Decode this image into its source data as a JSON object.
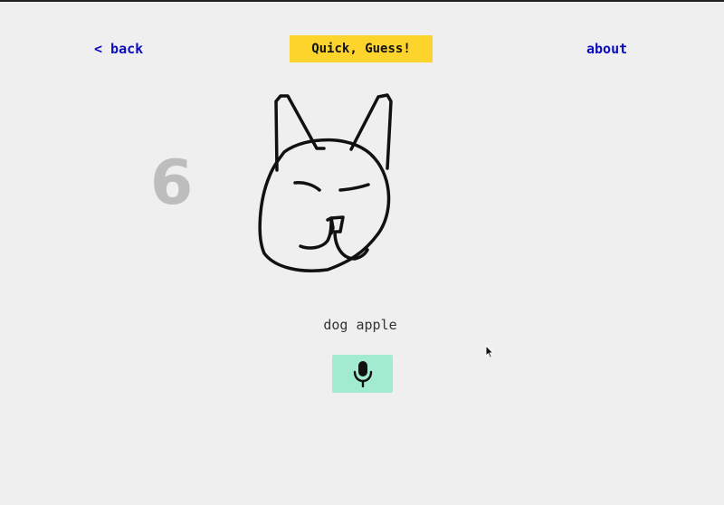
{
  "nav": {
    "back_label": "< back",
    "about_label": "about"
  },
  "header": {
    "title": "Quick, Guess!",
    "title_bg": "#fdd42c"
  },
  "game": {
    "countdown": "6",
    "drawing_subject": "cat-head-doodle",
    "guesses": "dog apple"
  },
  "controls": {
    "mic_icon": "microphone-icon",
    "mic_bg": "#a3ebd0"
  },
  "colors": {
    "link": "#0b0bbf",
    "background": "#efefef",
    "countdown": "#bdbdbd"
  }
}
